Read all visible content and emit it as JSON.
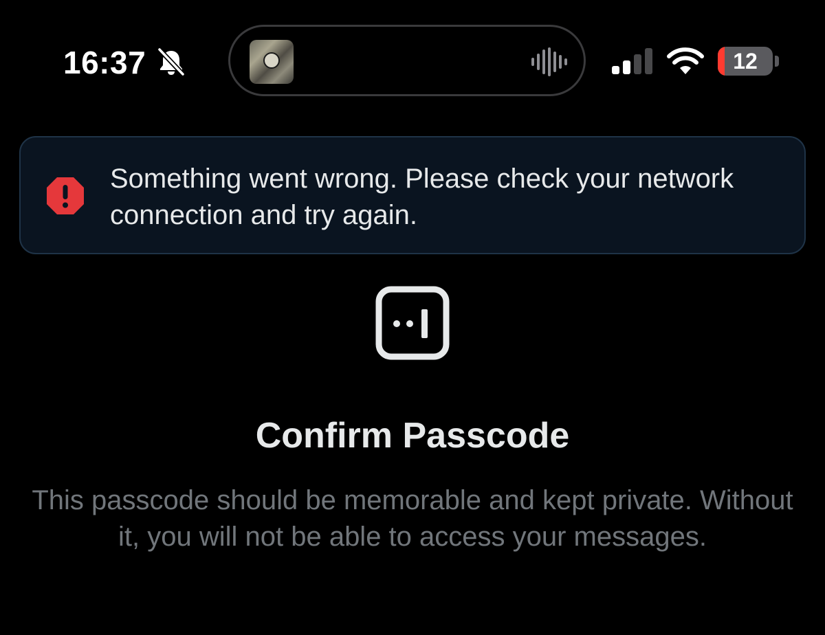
{
  "status_bar": {
    "time": "16:37",
    "silent_icon": "bell-slash-icon",
    "now_playing_icon": "waveform-icon",
    "signal_icon": "cell-signal-icon",
    "signal_bars_active": 2,
    "signal_bars_total": 4,
    "wifi_icon": "wifi-icon",
    "battery_level": "12",
    "battery_fraction": 0.12,
    "battery_color": "#ff3b30"
  },
  "error_banner": {
    "icon": "error-octagon-icon",
    "icon_color": "#e5383b",
    "message": "Something went wrong. Please check your network connection and try again."
  },
  "passcode": {
    "icon": "passcode-icon",
    "title": "Confirm Passcode",
    "description": "This passcode should be memorable and kept private. Without it, you will not be able to access your messages."
  },
  "colors": {
    "background": "#000000",
    "banner_background": "#0a1420",
    "banner_border": "#1f3347",
    "primary_text": "#e7e9ea",
    "secondary_text": "#71767b"
  }
}
